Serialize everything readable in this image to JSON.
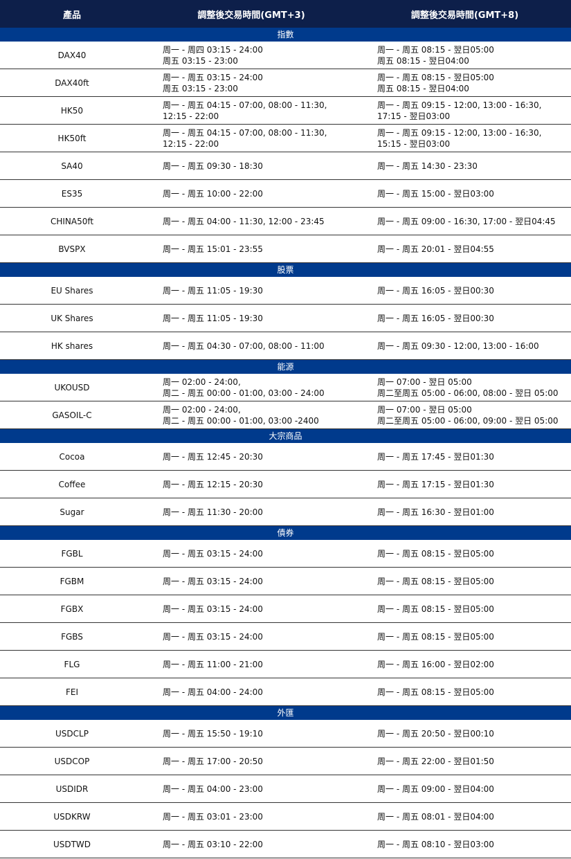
{
  "header": {
    "product": "產品",
    "gmt3": "調整後交易時間(GMT+3)",
    "gmt8": "調整後交易時間(GMT+8)"
  },
  "sections": [
    {
      "title": "指數",
      "rows": [
        {
          "product": "DAX40",
          "gmt3": "周一 - 周四 03:15 - 24:00\n周五 03:15 - 23:00",
          "gmt8": "周一 - 周五 08:15 - 翌日05:00\n周五 08:15 - 翌日04:00"
        },
        {
          "product": "DAX40ft",
          "gmt3": "周一 - 周五 03:15 - 24:00\n周五 03:15 - 23:00",
          "gmt8": "周一 - 周五 08:15 - 翌日05:00\n周五 08:15 - 翌日04:00"
        },
        {
          "product": "HK50",
          "gmt3": "周一 - 周五 04:15 - 07:00, 08:00 - 11:30,\n12:15 - 22:00",
          "gmt8": "周一 - 周五 09:15 - 12:00, 13:00 - 16:30,\n17:15 - 翌日03:00"
        },
        {
          "product": "HK50ft",
          "gmt3": "周一 - 周五 04:15 - 07:00, 08:00 - 11:30,\n12:15 - 22:00",
          "gmt8": "周一 - 周五 09:15 - 12:00, 13:00 - 16:30,\n15:15 - 翌日03:00"
        },
        {
          "product": "SA40",
          "gmt3": "周一 - 周五 09:30 - 18:30",
          "gmt8": "周一 - 周五 14:30 - 23:30"
        },
        {
          "product": "ES35",
          "gmt3": "周一 - 周五 10:00 - 22:00",
          "gmt8": "周一 - 周五 15:00 - 翌日03:00"
        },
        {
          "product": "CHINA50ft",
          "gmt3": "周一 - 周五 04:00 - 11:30, 12:00 - 23:45",
          "gmt8": "周一 - 周五 09:00 - 16:30, 17:00 - 翌日04:45"
        },
        {
          "product": "BVSPX",
          "gmt3": "周一 - 周五 15:01 - 23:55",
          "gmt8": "周一 - 周五 20:01 - 翌日04:55"
        }
      ]
    },
    {
      "title": "股票",
      "rows": [
        {
          "product": "EU Shares",
          "gmt3": "周一 - 周五 11:05 - 19:30",
          "gmt8": "周一 - 周五 16:05 - 翌日00:30"
        },
        {
          "product": "UK Shares",
          "gmt3": "周一 - 周五 11:05 - 19:30",
          "gmt8": "周一 - 周五 16:05 - 翌日00:30"
        },
        {
          "product": "HK shares",
          "gmt3": "周一 - 周五 04:30 - 07:00, 08:00 - 11:00",
          "gmt8": "周一 - 周五 09:30 - 12:00, 13:00 - 16:00"
        }
      ]
    },
    {
      "title": "能源",
      "rows": [
        {
          "product": "UKOUSD",
          "gmt3": "周一 02:00 - 24:00,\n周二 - 周五 00:00 - 01:00, 03:00 - 24:00",
          "gmt8": "周一 07:00 - 翌日 05:00\n周二至周五 05:00 - 06:00, 08:00 - 翌日 05:00"
        },
        {
          "product": "GASOIL-C",
          "gmt3": "周一 02:00 - 24:00,\n周二 - 周五 00:00 - 01:00, 03:00 -2400",
          "gmt8": "周一 07:00 - 翌日 05:00\n周二至周五 05:00 - 06:00, 09:00 - 翌日 05:00"
        }
      ]
    },
    {
      "title": "大宗商品",
      "rows": [
        {
          "product": "Cocoa",
          "gmt3": "周一 - 周五 12:45 - 20:30",
          "gmt8": "周一 - 周五 17:45 - 翌日01:30"
        },
        {
          "product": "Coffee",
          "gmt3": "周一 - 周五 12:15 - 20:30",
          "gmt8": "周一 - 周五 17:15 - 翌日01:30"
        },
        {
          "product": "Sugar",
          "gmt3": "周一 - 周五 11:30 - 20:00",
          "gmt8": "周一 - 周五 16:30 - 翌日01:00"
        }
      ]
    },
    {
      "title": "債券",
      "rows": [
        {
          "product": "FGBL",
          "gmt3": "周一 - 周五 03:15 - 24:00",
          "gmt8": "周一 - 周五 08:15 - 翌日05:00"
        },
        {
          "product": "FGBM",
          "gmt3": "周一 - 周五 03:15 - 24:00",
          "gmt8": "周一 - 周五 08:15 - 翌日05:00"
        },
        {
          "product": "FGBX",
          "gmt3": "周一 - 周五 03:15 - 24:00",
          "gmt8": "周一 - 周五 08:15 - 翌日05:00"
        },
        {
          "product": "FGBS",
          "gmt3": "周一 - 周五 03:15 - 24:00",
          "gmt8": "周一 - 周五 08:15 - 翌日05:00"
        },
        {
          "product": "FLG",
          "gmt3": "周一 - 周五 11:00 - 21:00",
          "gmt8": "周一 - 周五 16:00 - 翌日02:00"
        },
        {
          "product": "FEI",
          "gmt3": "周一 - 周五 04:00 - 24:00",
          "gmt8": "周一 - 周五 08:15 - 翌日05:00"
        }
      ]
    },
    {
      "title": "外匯",
      "rows": [
        {
          "product": "USDCLP",
          "gmt3": "周一 - 周五 15:50 - 19:10",
          "gmt8": "周一 - 周五 20:50 - 翌日00:10"
        },
        {
          "product": "USDCOP",
          "gmt3": "周一 - 周五 17:00 - 20:50",
          "gmt8": "周一 - 周五 22:00 - 翌日01:50"
        },
        {
          "product": "USDIDR",
          "gmt3": "周一 - 周五 04:00 - 23:00",
          "gmt8": "周一 - 周五 09:00 - 翌日04:00"
        },
        {
          "product": "USDKRW",
          "gmt3": "周一 - 周五 03:01 - 23:00",
          "gmt8": "周一 - 周五 08:01 - 翌日04:00"
        },
        {
          "product": "USDTWD",
          "gmt3": "周一 - 周五 03:10 - 22:00",
          "gmt8": "周一 - 周五 08:10 - 翌日03:00"
        }
      ]
    }
  ]
}
